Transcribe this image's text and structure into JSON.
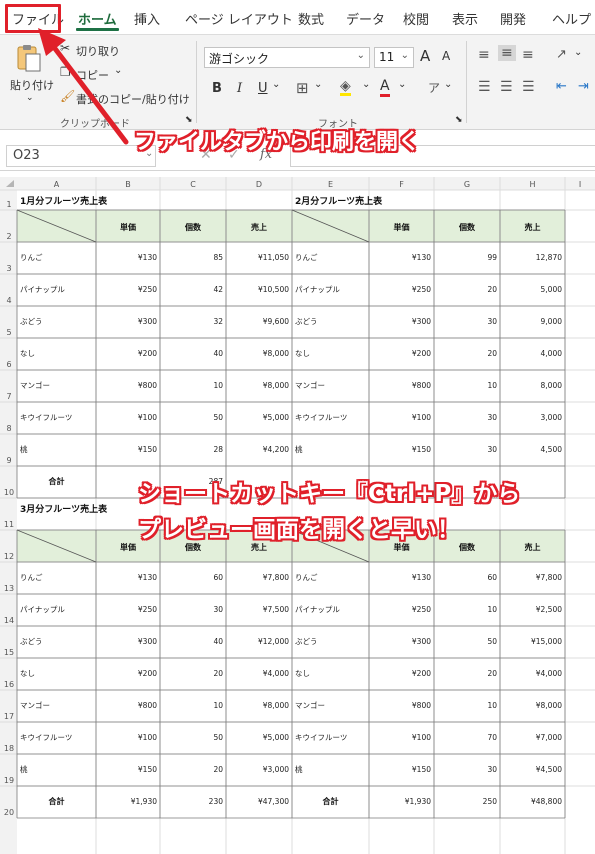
{
  "colors": {
    "accent": "#1e7145",
    "annotation": "#e0202a",
    "header_fill": "#e2efda"
  },
  "tabs": [
    {
      "label": "ファイル",
      "active": false
    },
    {
      "label": "ホーム",
      "active": true
    },
    {
      "label": "挿入",
      "active": false
    },
    {
      "label": "ページ レイアウト",
      "active": false
    },
    {
      "label": "数式",
      "active": false
    },
    {
      "label": "データ",
      "active": false
    },
    {
      "label": "校閲",
      "active": false
    },
    {
      "label": "表示",
      "active": false
    },
    {
      "label": "開発",
      "active": false
    },
    {
      "label": "ヘルプ",
      "active": false
    }
  ],
  "ribbon": {
    "paste_label": "貼り付け",
    "cut_label": "切り取り",
    "copy_label": "コピー",
    "format_copy_label": "書式のコピー/貼り付け",
    "clipboard_group": "クリップボード",
    "font_name": "游ゴシック",
    "font_size": "11",
    "font_group": "フォント",
    "bold": "B",
    "italic": "I",
    "underline": "U",
    "font_color_glyph": "A",
    "grow_font": "A",
    "shrink_font": "A"
  },
  "formula_bar": {
    "name_box": "O23",
    "fx": "fx"
  },
  "sheet": {
    "columns": [
      "A",
      "B",
      "C",
      "D",
      "E",
      "F",
      "G",
      "H",
      "I"
    ],
    "rows": [
      "1",
      "2",
      "3",
      "4",
      "5",
      "6",
      "7",
      "8",
      "9",
      "10",
      "11",
      "12",
      "13",
      "14",
      "15",
      "16",
      "17",
      "18",
      "19",
      "20"
    ],
    "tables": [
      {
        "title": "1月分フルーツ売上表",
        "headers": [
          "単価",
          "個数",
          "売上"
        ],
        "rows": [
          [
            "りんご",
            "¥130",
            "85",
            "¥11,050"
          ],
          [
            "パイナップル",
            "¥250",
            "42",
            "¥10,500"
          ],
          [
            "ぶどう",
            "¥300",
            "32",
            "¥9,600"
          ],
          [
            "なし",
            "¥200",
            "40",
            "¥8,000"
          ],
          [
            "マンゴー",
            "¥800",
            "10",
            "¥8,000"
          ],
          [
            "キウイフルーツ",
            "¥100",
            "50",
            "¥5,000"
          ],
          [
            "桃",
            "¥150",
            "28",
            "¥4,200"
          ]
        ],
        "total": [
          "合計",
          "",
          "287",
          ""
        ]
      },
      {
        "title": "2月分フルーツ売上表",
        "headers": [
          "単価",
          "個数",
          "売上"
        ],
        "rows": [
          [
            "りんご",
            "¥130",
            "99",
            "12,870"
          ],
          [
            "パイナップル",
            "¥250",
            "20",
            "5,000"
          ],
          [
            "ぶどう",
            "¥300",
            "30",
            "9,000"
          ],
          [
            "なし",
            "¥200",
            "20",
            "4,000"
          ],
          [
            "マンゴー",
            "¥800",
            "10",
            "8,000"
          ],
          [
            "キウイフルーツ",
            "¥100",
            "30",
            "3,000"
          ],
          [
            "桃",
            "¥150",
            "30",
            "4,500"
          ]
        ],
        "total": [
          "",
          "",
          "",
          ""
        ]
      },
      {
        "title": "3月分フルーツ売上表",
        "headers": [
          "単価",
          "個数",
          "売上"
        ],
        "rows": [
          [
            "りんご",
            "¥130",
            "60",
            "¥7,800"
          ],
          [
            "パイナップル",
            "¥250",
            "30",
            "¥7,500"
          ],
          [
            "ぶどう",
            "¥300",
            "40",
            "¥12,000"
          ],
          [
            "なし",
            "¥200",
            "20",
            "¥4,000"
          ],
          [
            "マンゴー",
            "¥800",
            "10",
            "¥8,000"
          ],
          [
            "キウイフルーツ",
            "¥100",
            "50",
            "¥5,000"
          ],
          [
            "桃",
            "¥150",
            "20",
            "¥3,000"
          ]
        ],
        "total": [
          "合計",
          "¥1,930",
          "230",
          "¥47,300"
        ]
      },
      {
        "title": "",
        "headers": [
          "単価",
          "個数",
          "売上"
        ],
        "rows": [
          [
            "りんご",
            "¥130",
            "60",
            "¥7,800"
          ],
          [
            "パイナップル",
            "¥250",
            "10",
            "¥2,500"
          ],
          [
            "ぶどう",
            "¥300",
            "50",
            "¥15,000"
          ],
          [
            "なし",
            "¥200",
            "20",
            "¥4,000"
          ],
          [
            "マンゴー",
            "¥800",
            "10",
            "¥8,000"
          ],
          [
            "キウイフルーツ",
            "¥100",
            "70",
            "¥7,000"
          ],
          [
            "桃",
            "¥150",
            "30",
            "¥4,500"
          ]
        ],
        "total": [
          "合計",
          "¥1,930",
          "250",
          "¥48,800"
        ]
      }
    ]
  },
  "annotations": {
    "open_print": "ファイルタブから印刷を開く",
    "shortcut_line1": "ショートカットキー『Ctrl+P』から",
    "shortcut_line2": "プレビュー画面を開くと早い！"
  }
}
